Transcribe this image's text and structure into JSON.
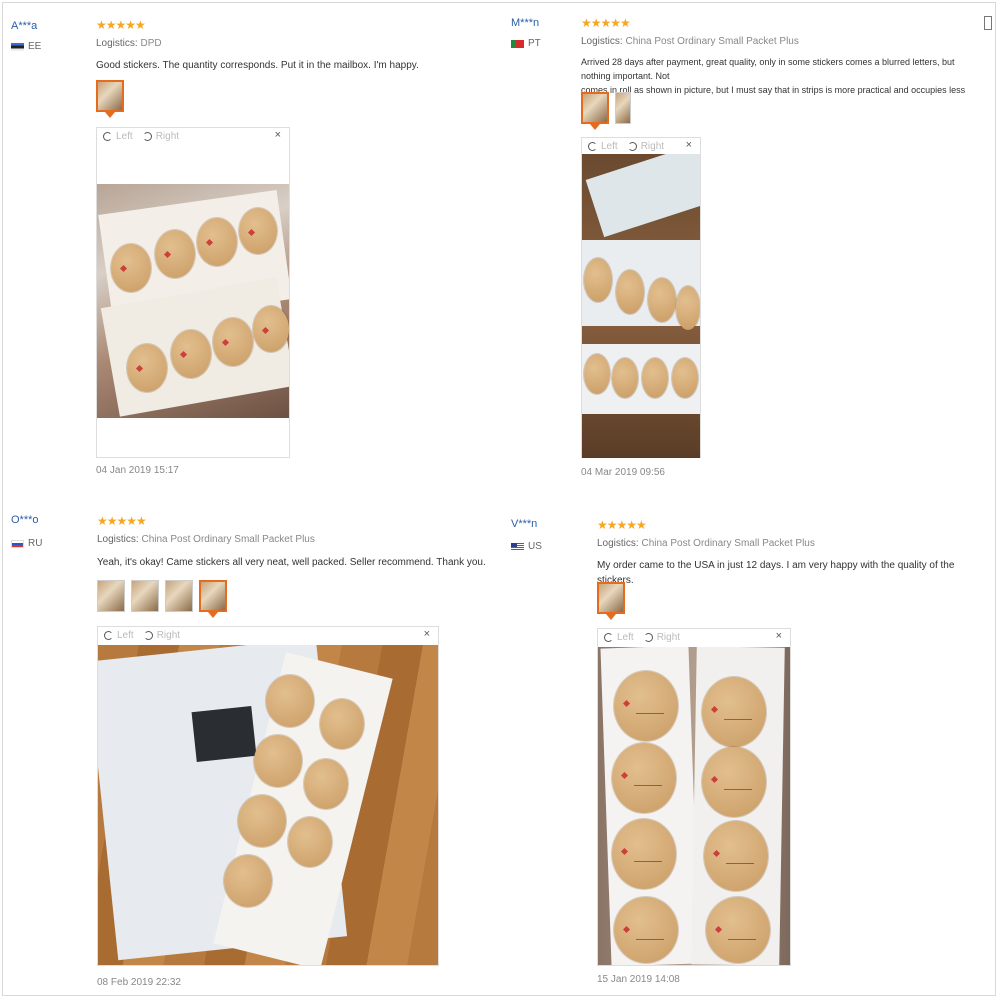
{
  "colors": {
    "accent": "#e56b1f",
    "star": "#f5a623",
    "username": "#2a5ea8"
  },
  "viewer": {
    "left_label": "Left",
    "right_label": "Right",
    "close_label": "×"
  },
  "reviews": [
    {
      "user": "A***a",
      "country": "EE",
      "flag": "estonia-flag",
      "stars": "★★★★★",
      "logistics_label": "Logistics:",
      "logistics": "DPD",
      "text": "Good stickers. The quantity corresponds. Put it in the mailbox. I'm happy.",
      "thumbnail_count": 1,
      "date": "04 Jan 2019 15:17"
    },
    {
      "user": "M***n",
      "country": "PT",
      "flag": "portugal-flag",
      "stars": "★★★★★",
      "logistics_label": "Logistics:",
      "logistics": "China Post Ordinary Small Packet Plus",
      "text_line1": "Arrived 28 days after payment, great quality, only in some stickers comes a blurred letters, but nothing important. Not",
      "text_line2": "comes in roll as shown in picture, but I must say that in strips is more practical and occupies less space.",
      "thumbnail_count": 2,
      "date": "04 Mar 2019 09:56"
    },
    {
      "user": "O***o",
      "country": "RU",
      "flag": "russia-flag",
      "stars": "★★★★★",
      "logistics_label": "Logistics:",
      "logistics": "China Post Ordinary Small Packet Plus",
      "text": "Yeah, it's okay! Came stickers all very neat, well packed. Seller recommend. Thank you.",
      "thumbnail_count": 4,
      "date": "08 Feb 2019 22:32"
    },
    {
      "user": "V***n",
      "country": "US",
      "flag": "usa-flag",
      "stars": "★★★★★",
      "logistics_label": "Logistics:",
      "logistics": "China Post Ordinary Small Packet Plus",
      "text": "My order came to the USA in just 12 days. I am very happy with the quality of the stickers.",
      "thumbnail_count": 1,
      "date": "15 Jan 2019 14:08"
    }
  ]
}
